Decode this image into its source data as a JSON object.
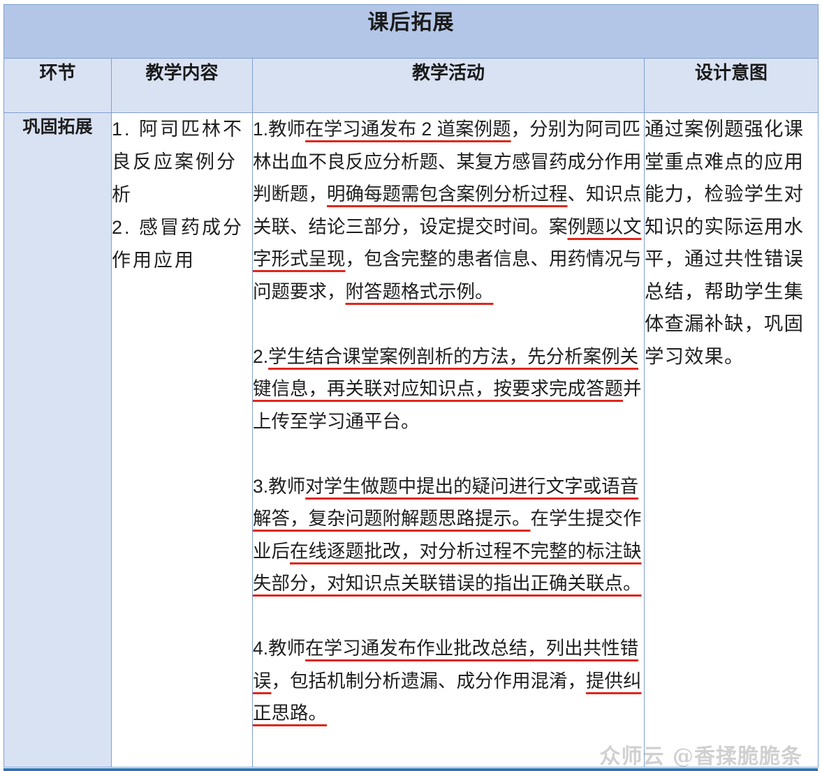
{
  "table": {
    "title": "课后拓展",
    "headers": [
      "环节",
      "教学内容",
      "教学活动",
      "设计意图"
    ],
    "stage": "巩固拓展",
    "content_items": [
      "1. 阿司匹林不",
      "良反应案例分",
      "析",
      "2. 感冒药成分",
      "作用应用"
    ],
    "activities": [
      [
        {
          "t": "1.教师",
          "u": false
        },
        {
          "t": "在学习通发布 2 道案例题",
          "u": true
        },
        {
          "t": "，分别为阿司匹林出血不良反应分析题、某复方感冒药成分作用判断题，",
          "u": false
        },
        {
          "t": "明确每题需包含案例分析过程",
          "u": true
        },
        {
          "t": "、知识点关联、结论三部分，设定提交时间。案",
          "u": false
        },
        {
          "t": "例题以文字形式呈现",
          "u": true
        },
        {
          "t": "，包含完整的患者信息、用药情况与问题要求，",
          "u": false
        },
        {
          "t": "附答题格式示例。",
          "u": true
        }
      ],
      [
        {
          "t": "2.",
          "u": false
        },
        {
          "t": "学生结合课堂案例剖析的方法，先分析案例关键信息，再关联对应知识点，按要求完成答题",
          "u": true
        },
        {
          "t": "并上传至学习通平台。",
          "u": false
        }
      ],
      [
        {
          "t": "3.教师",
          "u": false
        },
        {
          "t": "对学生做题中提出的疑问进行文字或语音解答，复杂问题附解题思路提示。",
          "u": true
        },
        {
          "t": "在学生提交作业后",
          "u": false
        },
        {
          "t": "在线逐题批改，对分析过程不完整的标注缺失部分，对知识点关联错误的指出正确关联点。",
          "u": true
        }
      ],
      [
        {
          "t": "4.教师",
          "u": false
        },
        {
          "t": "在学习通发布作业批改总结，列出共性错误",
          "u": true
        },
        {
          "t": "，包括机制分析遗漏、成分作用混淆，",
          "u": false
        },
        {
          "t": "提供纠正思路。",
          "u": true
        }
      ]
    ],
    "design_intent": "通过案例题强化课堂重点难点的应用能力，检验学生对知识的实际运用水平，通过共性错误总结，帮助学生集体查漏补缺，巩固学习效果。"
  },
  "watermark": "众师云 @香揉脆脆条"
}
